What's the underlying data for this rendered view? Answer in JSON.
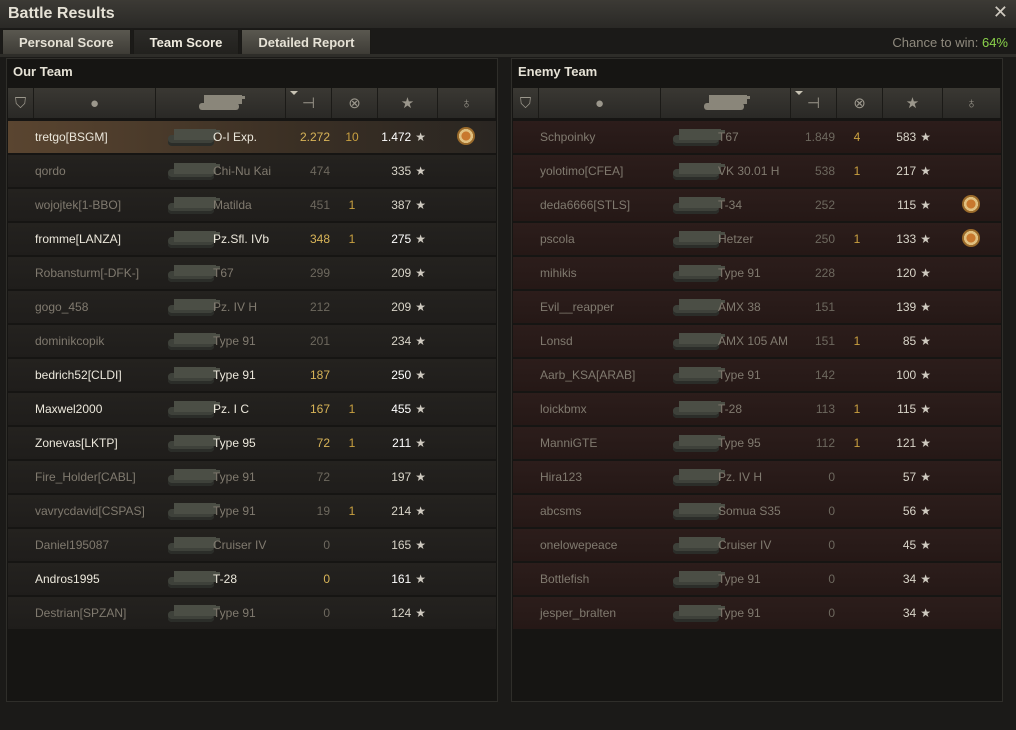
{
  "window": {
    "title": "Battle Results"
  },
  "tabs": [
    {
      "label": "Personal Score",
      "active": false
    },
    {
      "label": "Team Score",
      "active": true
    },
    {
      "label": "Detailed Report",
      "active": false
    }
  ],
  "chance": {
    "label": "Chance to win: ",
    "value": "64%"
  },
  "colors": {
    "accent_green": "#8ad24a",
    "highlight_row": "#5a4530",
    "enemy_row": "#2c1d1b",
    "kills_yellow": "#c9a040"
  },
  "our_team": {
    "title": "Our Team",
    "columns": [
      "squad-icon",
      "player-icon",
      "tank-icon",
      "damage-icon",
      "kills-icon",
      "xp-star-icon",
      "medal-icon"
    ],
    "rows": [
      {
        "player": "tretgo[BSGM]",
        "tank": "O-I Exp.",
        "damage": "2.272",
        "kills": "10",
        "xp": "1.472",
        "medal": true,
        "medal_count": "4",
        "highlight": true,
        "bright": true
      },
      {
        "player": "qordo",
        "tank": "Chi-Nu Kai",
        "damage": "474",
        "kills": "",
        "xp": "335",
        "medal": false
      },
      {
        "player": "wojojtek[1-BBO]",
        "tank": "Matilda",
        "damage": "451",
        "kills": "1",
        "xp": "387",
        "medal": false
      },
      {
        "player": "fromme[LANZA]",
        "tank": "Pz.Sfl. IVb",
        "damage": "348",
        "kills": "1",
        "xp": "275",
        "medal": false,
        "bright": true
      },
      {
        "player": "Robansturm[-DFK-]",
        "tank": "T67",
        "damage": "299",
        "kills": "",
        "xp": "209",
        "medal": false
      },
      {
        "player": "gogo_458",
        "tank": "Pz. IV H",
        "damage": "212",
        "kills": "",
        "xp": "209",
        "medal": false
      },
      {
        "player": "dominikcopik",
        "tank": "Type 91",
        "damage": "201",
        "kills": "",
        "xp": "234",
        "medal": false
      },
      {
        "player": "bedrich52[CLDI]",
        "tank": "Type 91",
        "damage": "187",
        "kills": "",
        "xp": "250",
        "medal": false,
        "bright": true
      },
      {
        "player": "Maxwel2000",
        "tank": "Pz. I C",
        "damage": "167",
        "kills": "1",
        "xp": "455",
        "medal": false,
        "bright": true
      },
      {
        "player": "Zonevas[LKTP]",
        "tank": "Type 95",
        "damage": "72",
        "kills": "1",
        "xp": "211",
        "medal": false,
        "bright": true
      },
      {
        "player": "Fire_Holder[CABL]",
        "tank": "Type 91",
        "damage": "72",
        "kills": "",
        "xp": "197",
        "medal": false
      },
      {
        "player": "vavrycdavid[CSPAS]",
        "tank": "Type 91",
        "damage": "19",
        "kills": "1",
        "xp": "214",
        "medal": false
      },
      {
        "player": "Daniel195087",
        "tank": "Cruiser IV",
        "damage": "0",
        "kills": "",
        "xp": "165",
        "medal": false
      },
      {
        "player": "Andros1995",
        "tank": "T-28",
        "damage": "0",
        "kills": "",
        "xp": "161",
        "medal": false,
        "bright": true
      },
      {
        "player": "Destrian[SPZAN]",
        "tank": "Type 91",
        "damage": "0",
        "kills": "",
        "xp": "124",
        "medal": false
      }
    ]
  },
  "enemy_team": {
    "title": "Enemy Team",
    "columns": [
      "squad-icon",
      "player-icon",
      "tank-icon",
      "damage-icon",
      "kills-icon",
      "xp-star-icon",
      "medal-icon"
    ],
    "rows": [
      {
        "player": "Schpoinky",
        "tank": "T67",
        "damage": "1.849",
        "kills": "4",
        "xp": "583",
        "medal": false
      },
      {
        "player": "yolotimo[CFEA]",
        "tank": "VK 30.01 H",
        "damage": "538",
        "kills": "1",
        "xp": "217",
        "medal": false
      },
      {
        "player": "deda6666[STLS]",
        "tank": "T-34",
        "damage": "252",
        "kills": "",
        "xp": "115",
        "medal": true
      },
      {
        "player": "pscola",
        "tank": "Hetzer",
        "damage": "250",
        "kills": "1",
        "xp": "133",
        "medal": true
      },
      {
        "player": "mihikis",
        "tank": "Type 91",
        "damage": "228",
        "kills": "",
        "xp": "120",
        "medal": false
      },
      {
        "player": "Evil__reapper",
        "tank": "AMX 38",
        "damage": "151",
        "kills": "",
        "xp": "139",
        "medal": false
      },
      {
        "player": "Lonsd",
        "tank": "AMX 105 AM",
        "damage": "151",
        "kills": "1",
        "xp": "85",
        "medal": false
      },
      {
        "player": "Aarb_KSA[ARAB]",
        "tank": "Type 91",
        "damage": "142",
        "kills": "",
        "xp": "100",
        "medal": false
      },
      {
        "player": "loickbmx",
        "tank": "T-28",
        "damage": "113",
        "kills": "1",
        "xp": "115",
        "medal": false
      },
      {
        "player": "ManniGTE",
        "tank": "Type 95",
        "damage": "112",
        "kills": "1",
        "xp": "121",
        "medal": false
      },
      {
        "player": "Hira123",
        "tank": "Pz. IV H",
        "damage": "0",
        "kills": "",
        "xp": "57",
        "medal": false
      },
      {
        "player": "abcsms",
        "tank": "Somua S35",
        "damage": "0",
        "kills": "",
        "xp": "56",
        "medal": false
      },
      {
        "player": "onelowepeace",
        "tank": "Cruiser IV",
        "damage": "0",
        "kills": "",
        "xp": "45",
        "medal": false
      },
      {
        "player": "Bottlefish",
        "tank": "Type 91",
        "damage": "0",
        "kills": "",
        "xp": "34",
        "medal": false
      },
      {
        "player": "jesper_bralten",
        "tank": "Type 91",
        "damage": "0",
        "kills": "",
        "xp": "34",
        "medal": false
      }
    ]
  }
}
